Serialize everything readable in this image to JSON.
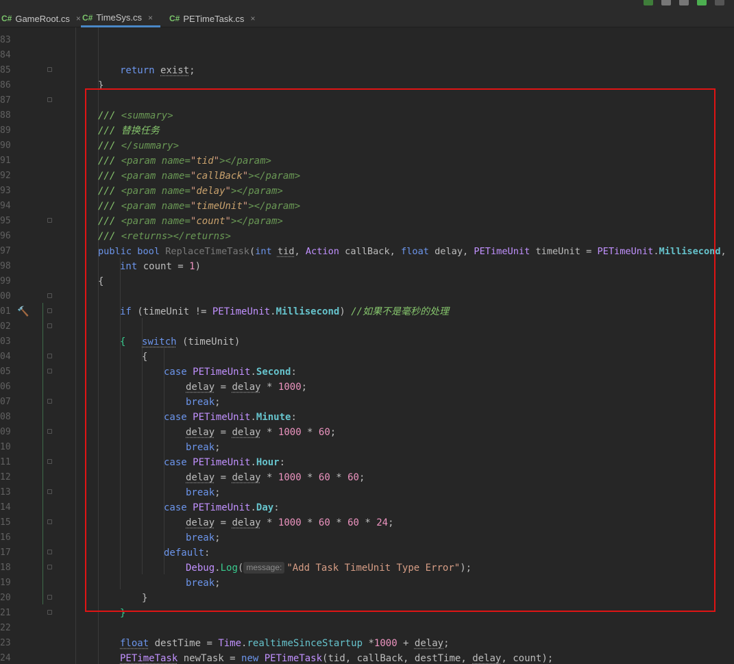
{
  "tabs": [
    {
      "icon": "C#",
      "label": "GameRoot.cs",
      "active": false
    },
    {
      "icon": "C#",
      "label": "TimeSys.cs",
      "active": true
    },
    {
      "icon": "C#",
      "label": "PETimeTask.cs",
      "active": false
    }
  ],
  "close_glyph": "×",
  "gutter_numbers": [
    "83",
    "84",
    "85",
    "86",
    "87",
    "88",
    "89",
    "90",
    "91",
    "92",
    "93",
    "94",
    "95",
    "96",
    "97",
    "98",
    "99",
    "00",
    "01",
    "02",
    "03",
    "04",
    "05",
    "06",
    "07",
    "08",
    "09",
    "10",
    "11",
    "12",
    "13",
    "14",
    "15",
    "16",
    "17",
    "18",
    "19",
    "20",
    "21",
    "22",
    "23",
    "24"
  ],
  "colors": {
    "highlight_box": "#e01414",
    "keyword": "#6c95eb",
    "comment": "#85c46c",
    "enum": "#66c3cc",
    "number": "#ed94c0"
  },
  "code": {
    "l84": {
      "kw": "return",
      "id": "exist",
      "end": ";"
    },
    "l85": "}",
    "l87": {
      "slashes": "///",
      "open": "<",
      "tag": "summary",
      "close": ">"
    },
    "l88": {
      "slashes": "///",
      "text": "替换任务"
    },
    "l89": {
      "slashes": "///",
      "open": "</",
      "tag": "summary",
      "close": ">"
    },
    "l90": {
      "slashes": "///",
      "name": "tid"
    },
    "l91": {
      "slashes": "///",
      "name": "callBack"
    },
    "l92": {
      "slashes": "///",
      "name": "delay"
    },
    "l93": {
      "slashes": "///",
      "name": "timeUnit"
    },
    "l94": {
      "slashes": "///",
      "name": "count"
    },
    "l95": {
      "slashes": "///",
      "returns": "<returns></returns>"
    },
    "param_open": "<",
    "param_tag": "param",
    "param_attr": "name=",
    "param_close": "></",
    "param_end": ">",
    "l96": {
      "public": "public",
      "bool": "bool",
      "method": "ReplaceTimeTask",
      "p1": "(",
      "int": "int",
      "tid": "tid",
      "c1": ", ",
      "action": "Action",
      "cb": " callBack, ",
      "float": "float",
      "delay": " delay, ",
      "petu": "PETimeUnit",
      "tu": " timeUnit = ",
      "petu2": "PETimeUnit",
      "dot": ".",
      "ms": "Millisecond",
      "comma": ","
    },
    "l97": {
      "int": "int",
      "count": " count = ",
      "one": "1",
      "end": ")"
    },
    "l98": "{",
    "l100": {
      "if": "if",
      "cond1": " (timeUnit != ",
      "petu": "PETimeUnit",
      "dot": ".",
      "ms": "Millisecond",
      "cond2": ") ",
      "comment": "//如果不是毫秒的处理"
    },
    "l101": "{",
    "l102": {
      "switch": "switch",
      "arg": " (timeUnit)"
    },
    "l103": "{",
    "case_kw": "case",
    "petu": "PETimeUnit",
    "dot": ".",
    "colon": ":",
    "delay": "delay",
    "eq": " = ",
    "times": " * ",
    "semi": ";",
    "break": "break",
    "l104": "Second",
    "l105": [
      "1000"
    ],
    "l107": "Minute",
    "l108": [
      "1000",
      "60"
    ],
    "l110": "Hour",
    "l111": [
      "1000",
      "60",
      "60"
    ],
    "l113": "Day",
    "l114": [
      "1000",
      "60",
      "60",
      "24"
    ],
    "l116": {
      "default": "default",
      "colon": ":"
    },
    "l117": {
      "debug": "Debug",
      "dot": ".",
      "log": "Log",
      "p1": "(",
      "hint": "message:",
      "msg": "\"Add Task TimeUnit Type Error\"",
      "end": ");"
    },
    "l119": "}",
    "l120": "}",
    "l122": {
      "float": "float",
      "dt": " destTime = ",
      "time": "Time",
      "dot": ".",
      "rss": "realtimeSinceStartup",
      "mul": " *",
      "num": "1000",
      "plus": " + ",
      "delay": "delay",
      "end": ";"
    },
    "l123": {
      "type": "PETimeTask",
      "nt": " newTask = ",
      "new": "new",
      "type2": "PETimeTask",
      "args1": "(tid, callBack, destTime, ",
      "delay": "delay",
      "args2": ", count);"
    }
  }
}
